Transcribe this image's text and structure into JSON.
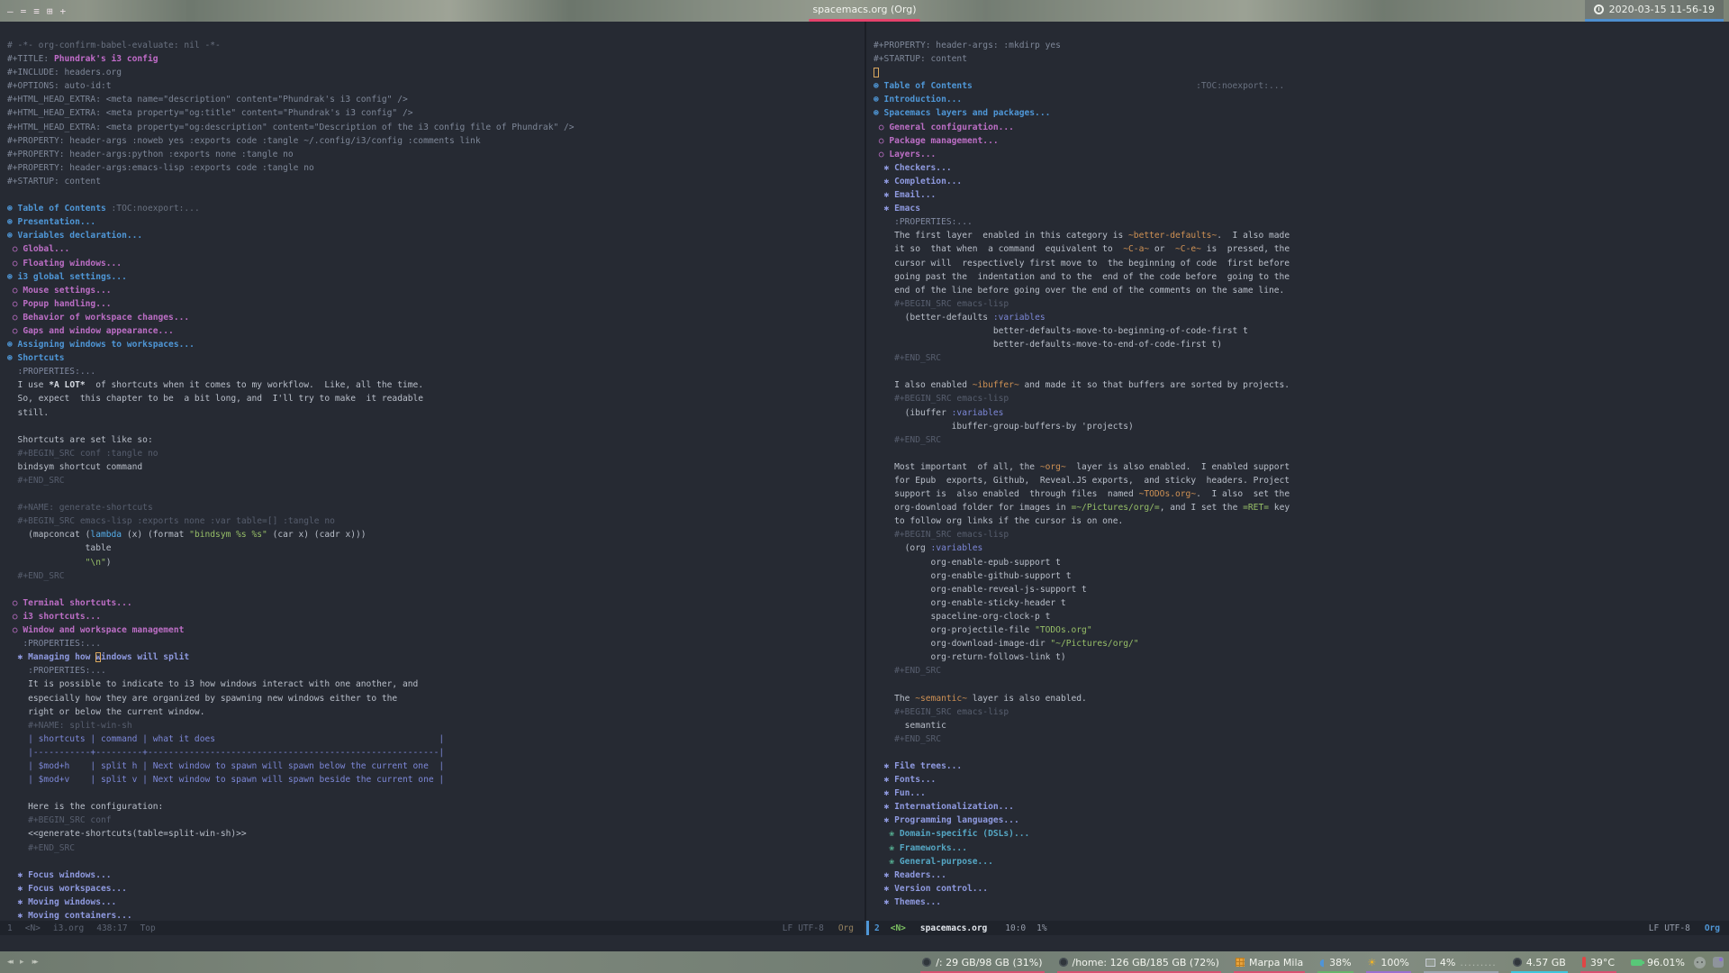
{
  "topbar": {
    "window_icons": [
      "–",
      "=",
      "≡",
      "⊞",
      "+"
    ],
    "title": "spacemacs.org (Org)",
    "clock": "2020-03-15 11-56-19"
  },
  "colors": {
    "editor_bg": "#262a33",
    "accent_blue": "#4f97d7",
    "heading2_magenta": "#bc6ec5",
    "heading3_periwinkle": "#8f9ae0",
    "heading4_cyan": "#55a7c4",
    "string_green": "#97bf68",
    "verbatim_orange": "#cf9154",
    "cursor_orange": "#d9a75e",
    "title_underline_pink": "#e5426b",
    "clock_underline_blue": "#4e8fd0",
    "modeline_active_bar": "#4f97d7"
  },
  "left_window": {
    "modeline": {
      "window_number": "1",
      "state": "<N>",
      "buffer_name": "i3.org",
      "position": "438:17",
      "scroll": "Top",
      "line_ending": "LF",
      "encoding": "UTF-8",
      "major_mode": "Org"
    },
    "lines": [
      [
        [
          "c",
          "# -*- org-confirm-babel-evaluate: nil -*-"
        ]
      ],
      [
        [
          "m",
          "#+TITLE: "
        ],
        [
          "ttl",
          "Phundrak's i3 config"
        ]
      ],
      [
        [
          "m",
          "#+INCLUDE: headers.org"
        ]
      ],
      [
        [
          "m",
          "#+OPTIONS: auto-id:t"
        ]
      ],
      [
        [
          "m",
          "#+HTML_HEAD_EXTRA: <meta name=\"description\" content=\"Phundrak's i3 config\" />"
        ]
      ],
      [
        [
          "m",
          "#+HTML_HEAD_EXTRA: <meta property=\"og:title\" content=\"Phundrak's i3 config\" />"
        ]
      ],
      [
        [
          "m",
          "#+HTML_HEAD_EXTRA: <meta property=\"og:description\" content=\"Description of the i3 config file of Phundrak\" />"
        ]
      ],
      [
        [
          "m",
          "#+PROPERTY: header-args :noweb yes :exports code :tangle ~/.config/i3/config :comments link"
        ]
      ],
      [
        [
          "m",
          "#+PROPERTY: header-args:python :exports none :tangle no"
        ]
      ],
      [
        [
          "m",
          "#+PROPERTY: header-args:emacs-lisp :exports code :tangle no"
        ]
      ],
      [
        [
          "m",
          "#+STARTUP: content"
        ]
      ],
      [],
      [
        [
          "h1",
          "⊛ Table of Contents"
        ],
        [
          "t",
          " "
        ],
        [
          "tg",
          ":TOC:noexport:..."
        ]
      ],
      [
        [
          "h1",
          "⊛ Presentation..."
        ]
      ],
      [
        [
          "h1",
          "⊛ Variables declaration..."
        ]
      ],
      [
        [
          "h2",
          " ○ Global..."
        ]
      ],
      [
        [
          "h2",
          " ○ Floating windows..."
        ]
      ],
      [
        [
          "h1",
          "⊛ i3 global settings..."
        ]
      ],
      [
        [
          "h2",
          " ○ Mouse settings..."
        ]
      ],
      [
        [
          "h2",
          " ○ Popup handling..."
        ]
      ],
      [
        [
          "h2",
          " ○ Behavior of workspace changes..."
        ]
      ],
      [
        [
          "h2",
          " ○ Gaps and window appearance..."
        ]
      ],
      [
        [
          "h1",
          "⊛ Assigning windows to workspaces..."
        ]
      ],
      [
        [
          "h1",
          "⊛ Shortcuts"
        ]
      ],
      [
        [
          "dr",
          "  :PROPERTIES:..."
        ]
      ],
      [
        [
          "t",
          "  I use "
        ],
        [
          "b",
          "*A LOT*"
        ],
        [
          "t",
          "  of shortcuts when it comes to my workflow.  Like, all the time."
        ]
      ],
      [
        [
          "t",
          "  So, expect  this chapter to be  a bit long, and  I'll try to make  it readable"
        ]
      ],
      [
        [
          "t",
          "  still."
        ]
      ],
      [],
      [
        [
          "t",
          "  Shortcuts are set like so:"
        ]
      ],
      [
        [
          "d",
          "  #+BEGIN_SRC conf :tangle no"
        ]
      ],
      [
        [
          "t",
          "  bindsym shortcut command"
        ]
      ],
      [
        [
          "d",
          "  #+END_SRC"
        ]
      ],
      [],
      [
        [
          "d",
          "  #+NAME: generate-shortcuts"
        ]
      ],
      [
        [
          "d",
          "  #+BEGIN_SRC emacs-lisp :exports none :var table=[] :tangle no"
        ]
      ],
      [
        [
          "t",
          "    (mapconcat ("
        ],
        [
          "k",
          "lambda"
        ],
        [
          "t",
          " (x) (format "
        ],
        [
          "s",
          "\"bindsym %s %s\""
        ],
        [
          "t",
          " (car x) (cadr x)))"
        ]
      ],
      [
        [
          "t",
          "               table"
        ]
      ],
      [
        [
          "t",
          "               "
        ],
        [
          "s",
          "\"\\n\""
        ],
        [
          "t",
          ")"
        ]
      ],
      [
        [
          "d",
          "  #+END_SRC"
        ]
      ],
      [],
      [
        [
          "h2",
          " ○ Terminal shortcuts..."
        ]
      ],
      [
        [
          "h2",
          " ○ i3 shortcuts..."
        ]
      ],
      [
        [
          "h2",
          " ○ Window and workspace management"
        ]
      ],
      [
        [
          "dr",
          "   :PROPERTIES:..."
        ]
      ],
      [
        [
          "h3",
          "  ✱ Managing how "
        ],
        [
          "h3 cur",
          "w"
        ],
        [
          "h3",
          "indows will split"
        ]
      ],
      [
        [
          "dr",
          "    :PROPERTIES:..."
        ]
      ],
      [
        [
          "t",
          "    It is possible to indicate to i3 how windows interact with one another, and"
        ]
      ],
      [
        [
          "t",
          "    especially how they are organized by spawning new windows either to the"
        ]
      ],
      [
        [
          "t",
          "    right or below the current window."
        ]
      ],
      [
        [
          "d",
          "    #+NAME: split-win-sh"
        ]
      ],
      [
        [
          "tb",
          "    | shortcuts | command | what it does                                           |"
        ]
      ],
      [
        [
          "tb",
          "    |-----------+---------+--------------------------------------------------------|"
        ]
      ],
      [
        [
          "tb",
          "    | $mod+h    | split h | Next window to spawn will spawn below the current one  |"
        ]
      ],
      [
        [
          "tb",
          "    | $mod+v    | split v | Next window to spawn will spawn beside the current one |"
        ]
      ],
      [],
      [
        [
          "t",
          "    Here is the configuration:"
        ]
      ],
      [
        [
          "d",
          "    #+BEGIN_SRC conf"
        ]
      ],
      [
        [
          "t",
          "    <<generate-shortcuts(table=split-win-sh)>>"
        ]
      ],
      [
        [
          "d",
          "    #+END_SRC"
        ]
      ],
      [],
      [
        [
          "h3",
          "  ✱ Focus windows..."
        ]
      ],
      [
        [
          "h3",
          "  ✱ Focus workspaces..."
        ]
      ],
      [
        [
          "h3",
          "  ✱ Moving windows..."
        ]
      ],
      [
        [
          "h3",
          "  ✱ Moving containers..."
        ]
      ]
    ]
  },
  "right_window": {
    "modeline": {
      "window_number": "2",
      "state": "<N>",
      "buffer_name": "spacemacs.org",
      "position": "10:0",
      "scroll": "1%",
      "line_ending": "LF",
      "encoding": "UTF-8",
      "major_mode": "Org"
    },
    "lines": [
      [
        [
          "m",
          "#+PROPERTY: header-args: :mkdirp yes"
        ]
      ],
      [
        [
          "m",
          "#+STARTUP: content"
        ]
      ],
      [
        [
          "cur",
          " "
        ]
      ],
      [
        [
          "h1",
          "⊛ Table of Contents"
        ],
        [
          "t",
          "                                           "
        ],
        [
          "tg",
          ":TOC:noexport:..."
        ]
      ],
      [
        [
          "h1",
          "⊛ Introduction..."
        ]
      ],
      [
        [
          "h1",
          "⊛ Spacemacs layers and packages..."
        ]
      ],
      [
        [
          "h2",
          " ○ General configuration..."
        ]
      ],
      [
        [
          "h2",
          " ○ Package management..."
        ]
      ],
      [
        [
          "h2",
          " ○ Layers..."
        ]
      ],
      [
        [
          "h3",
          "  ✱ Checkers..."
        ]
      ],
      [
        [
          "h3",
          "  ✱ Completion..."
        ]
      ],
      [
        [
          "h3",
          "  ✱ Email..."
        ]
      ],
      [
        [
          "h3",
          "  ✱ Emacs"
        ]
      ],
      [
        [
          "dr",
          "    :PROPERTIES:..."
        ]
      ],
      [
        [
          "t",
          "    The first layer  enabled in this category is "
        ],
        [
          "o",
          "~better-defaults~"
        ],
        [
          "t",
          ".  I also made"
        ]
      ],
      [
        [
          "t",
          "    it so  that when  a command  equivalent to  "
        ],
        [
          "o",
          "~C-a~"
        ],
        [
          "t",
          " or  "
        ],
        [
          "o",
          "~C-e~"
        ],
        [
          "t",
          " is  pressed, the"
        ]
      ],
      [
        [
          "t",
          "    cursor will  respectively first move to  the beginning of code  first before"
        ]
      ],
      [
        [
          "t",
          "    going past the  indentation and to the  end of the code before  going to the"
        ]
      ],
      [
        [
          "t",
          "    end of the line before going over the end of the comments on the same line."
        ]
      ],
      [
        [
          "d",
          "    #+BEGIN_SRC emacs-lisp"
        ]
      ],
      [
        [
          "t",
          "      (better-defaults "
        ],
        [
          "kw",
          ":variables"
        ]
      ],
      [
        [
          "t",
          "                       better-defaults-move-to-beginning-of-code-first t"
        ]
      ],
      [
        [
          "t",
          "                       better-defaults-move-to-end-of-code-first t)"
        ]
      ],
      [
        [
          "d",
          "    #+END_SRC"
        ]
      ],
      [],
      [
        [
          "t",
          "    I also enabled "
        ],
        [
          "o",
          "~ibuffer~"
        ],
        [
          "t",
          " and made it so that buffers are sorted by projects."
        ]
      ],
      [
        [
          "d",
          "    #+BEGIN_SRC emacs-lisp"
        ]
      ],
      [
        [
          "t",
          "      (ibuffer "
        ],
        [
          "kw",
          ":variables"
        ]
      ],
      [
        [
          "t",
          "               ibuffer-group-buffers-by 'projects)"
        ]
      ],
      [
        [
          "d",
          "    #+END_SRC"
        ]
      ],
      [],
      [
        [
          "t",
          "    Most important  of all, the "
        ],
        [
          "o",
          "~org~"
        ],
        [
          "t",
          "  layer is also enabled.  I enabled support"
        ]
      ],
      [
        [
          "t",
          "    for Epub  exports, Github,  Reveal.JS exports,  and sticky  headers. Project"
        ]
      ],
      [
        [
          "t",
          "    support is  also enabled  through files  named "
        ],
        [
          "o",
          "~TODOs.org~"
        ],
        [
          "t",
          ".  I also  set the"
        ]
      ],
      [
        [
          "t",
          "    org-download folder for images in "
        ],
        [
          "v",
          "=~/Pictures/org/="
        ],
        [
          "t",
          ", and I set the "
        ],
        [
          "v",
          "=RET="
        ],
        [
          "t",
          " key"
        ]
      ],
      [
        [
          "t",
          "    to follow org links if the cursor is on one."
        ]
      ],
      [
        [
          "d",
          "    #+BEGIN_SRC emacs-lisp"
        ]
      ],
      [
        [
          "t",
          "      (org "
        ],
        [
          "kw",
          ":variables"
        ]
      ],
      [
        [
          "t",
          "           org-enable-epub-support t"
        ]
      ],
      [
        [
          "t",
          "           org-enable-github-support t"
        ]
      ],
      [
        [
          "t",
          "           org-enable-reveal-js-support t"
        ]
      ],
      [
        [
          "t",
          "           org-enable-sticky-header t"
        ]
      ],
      [
        [
          "t",
          "           spaceline-org-clock-p t"
        ]
      ],
      [
        [
          "t",
          "           org-projectile-file "
        ],
        [
          "s",
          "\"TODOs.org\""
        ]
      ],
      [
        [
          "t",
          "           org-download-image-dir "
        ],
        [
          "s",
          "\"~/Pictures/org/\""
        ]
      ],
      [
        [
          "t",
          "           org-return-follows-link t)"
        ]
      ],
      [
        [
          "d",
          "    #+END_SRC"
        ]
      ],
      [],
      [
        [
          "t",
          "    The "
        ],
        [
          "o",
          "~semantic~"
        ],
        [
          "t",
          " layer is also enabled."
        ]
      ],
      [
        [
          "d",
          "    #+BEGIN_SRC emacs-lisp"
        ]
      ],
      [
        [
          "t",
          "      semantic"
        ]
      ],
      [
        [
          "d",
          "    #+END_SRC"
        ]
      ],
      [],
      [
        [
          "h3",
          "  ✱ File trees..."
        ]
      ],
      [
        [
          "h3",
          "  ✱ Fonts..."
        ]
      ],
      [
        [
          "h3",
          "  ✱ Fun..."
        ]
      ],
      [
        [
          "h3",
          "  ✱ Internationalization..."
        ]
      ],
      [
        [
          "h3",
          "  ✱ Programming languages..."
        ]
      ],
      [
        [
          "b4",
          "   ❀ "
        ],
        [
          "h4",
          "Domain-specific (DSLs)..."
        ]
      ],
      [
        [
          "b4",
          "   ❀ "
        ],
        [
          "h4",
          "Frameworks..."
        ]
      ],
      [
        [
          "b4",
          "   ❀ "
        ],
        [
          "h4",
          "General-purpose..."
        ]
      ],
      [
        [
          "h3",
          "  ✱ Readers..."
        ]
      ],
      [
        [
          "h3",
          "  ✱ Version control..."
        ]
      ],
      [
        [
          "h3",
          "  ✱ Themes..."
        ]
      ]
    ]
  },
  "bottombar": {
    "modules": [
      {
        "name": "disk-root",
        "text": "/: 29 GB/98 GB (31%)",
        "underline": "#d94f70"
      },
      {
        "name": "disk-home",
        "text": "/home: 126 GB/185 GB (72%)",
        "underline": "#d94f70"
      },
      {
        "name": "music",
        "text": "Marpa Mila",
        "underline": "#d94f70"
      },
      {
        "name": "volume",
        "text": "38%",
        "underline": "#68b36b"
      },
      {
        "name": "brightness",
        "text": "100%",
        "underline": "#9a6fd0"
      },
      {
        "name": "cpu",
        "text": "4%",
        "dots": ".........",
        "underline": "#9aa5b1"
      },
      {
        "name": "memory",
        "text": "4.57 GB",
        "underline": "#3fc6dd"
      },
      {
        "name": "temperature",
        "text": "39°C",
        "underline": "#d94f70"
      },
      {
        "name": "battery",
        "text": "96.01%",
        "underline": ""
      }
    ]
  }
}
